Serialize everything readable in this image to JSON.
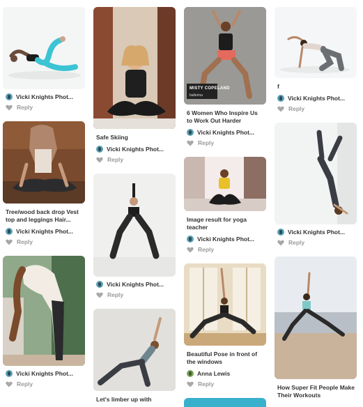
{
  "pins": {
    "p1": {
      "source": "Vicki Knights Phot...",
      "reply": "Reply"
    },
    "p2": {
      "desc": "Tree/wood back drop Vest top and leggings Hair...",
      "source": "Vicki Knights Phot...",
      "reply": "Reply"
    },
    "p3": {
      "source": "Vicki Knights Phot...",
      "reply": "Reply"
    },
    "p4": {
      "desc": "Safe Skiing",
      "source": "Vicki Knights Phot...",
      "reply": "Reply"
    },
    "p5": {
      "source": "Vicki Knights Phot...",
      "reply": "Reply"
    },
    "p6": {
      "desc": "Let's limber up with"
    },
    "p7": {
      "overlay": "MISTY COPELAND",
      "overlay_sub": "ballerina",
      "desc": "6 Women Who Inspire Us to Work Out Harder",
      "source": "Vicki Knights Phot...",
      "reply": "Reply"
    },
    "p8": {
      "desc": "Image result for yoga teacher",
      "source": "Vicki Knights Phot...",
      "reply": "Reply"
    },
    "p9": {
      "desc": "Beautiful Pose in front of the windows",
      "source": "Anna Lewis",
      "reply": "Reply"
    },
    "p10": {
      "desc": "f",
      "source": "Vicki Knights Phot...",
      "reply": "Reply"
    },
    "p11": {
      "source": "Vicki Knights Phot...",
      "reply": "Reply"
    },
    "p12": {
      "desc": "How Super Fit People Make Their Workouts"
    }
  },
  "colors": {
    "text": "#333333",
    "muted": "#9a9a9a",
    "avatar": "#5aa0b4"
  },
  "icons": {
    "reply": "heart-icon",
    "avatar": "user-avatar"
  }
}
